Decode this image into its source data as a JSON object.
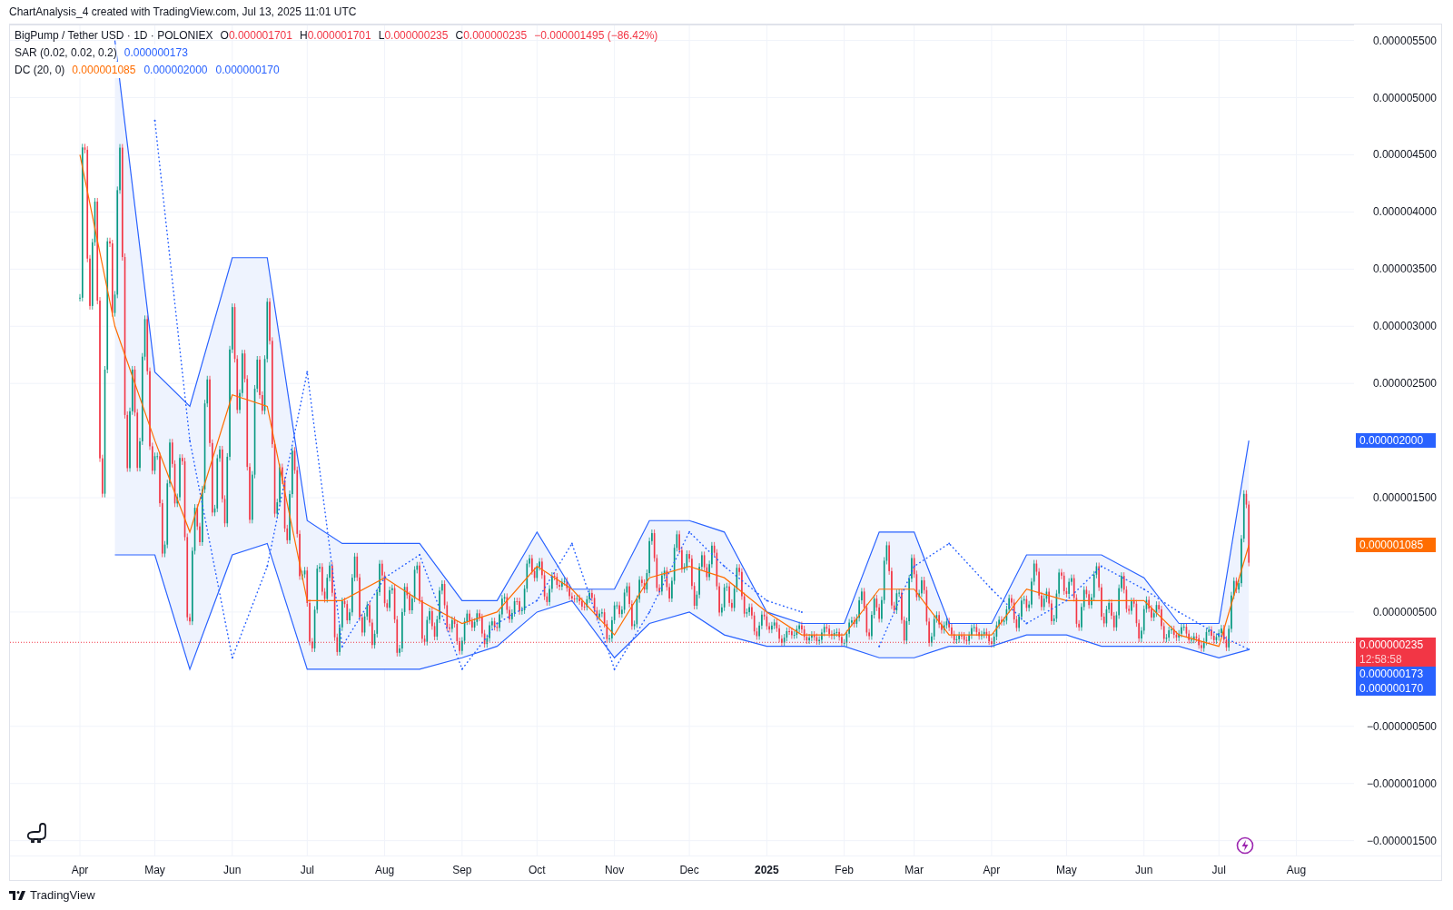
{
  "attribution": "ChartAnalysis_4 created with TradingView.com, Jul 13, 2025 11:01 UTC",
  "legend": {
    "symbol": "BigPump / Tether USD · 1D · POLONIEX",
    "ohlc": [
      {
        "label": "O",
        "value": "0.000001701"
      },
      {
        "label": "H",
        "value": "0.000001701"
      },
      {
        "label": "L",
        "value": "0.000000235"
      },
      {
        "label": "C",
        "value": "0.000000235"
      }
    ],
    "change": "−0.000001495 (−86.42%)",
    "indicators": [
      {
        "name": "SAR (0.02, 0.02, 0.2)",
        "values": [
          {
            "text": "0.000000173",
            "color": "#2962ff"
          }
        ]
      },
      {
        "name": "DC (20, 0)",
        "values": [
          {
            "text": "0.000001085",
            "color": "#ff6d00"
          },
          {
            "text": "0.000002000",
            "color": "#2962ff"
          },
          {
            "text": "0.000000170",
            "color": "#2962ff"
          }
        ]
      }
    ]
  },
  "chart": {
    "chart_data": {
      "type": "line",
      "grid": true,
      "xlim": [
        "2024-03-04",
        "2025-09-28"
      ],
      "ylim": [
        -1.63e-06,
        5.64e-06
      ],
      "x": [
        "2024-04-01",
        "2024-04-15",
        "2024-05-01",
        "2024-05-15",
        "2024-06-01",
        "2024-06-15",
        "2024-07-01",
        "2024-07-15",
        "2024-08-01",
        "2024-08-15",
        "2024-09-01",
        "2024-09-15",
        "2024-10-01",
        "2024-10-15",
        "2024-11-01",
        "2024-11-15",
        "2024-12-01",
        "2024-12-15",
        "2025-01-01",
        "2025-01-15",
        "2025-02-01",
        "2025-02-15",
        "2025-03-01",
        "2025-03-15",
        "2025-04-01",
        "2025-04-15",
        "2025-05-01",
        "2025-05-15",
        "2025-06-01",
        "2025-06-15",
        "2025-07-01",
        "2025-07-13"
      ],
      "xticks": [
        {
          "value": "2024-04-01",
          "label": "Apr"
        },
        {
          "value": "2024-05-01",
          "label": "May"
        },
        {
          "value": "2024-06-01",
          "label": "Jun"
        },
        {
          "value": "2024-07-01",
          "label": "Jul"
        },
        {
          "value": "2024-08-01",
          "label": "Aug"
        },
        {
          "value": "2024-09-01",
          "label": "Sep"
        },
        {
          "value": "2024-10-01",
          "label": "Oct"
        },
        {
          "value": "2024-11-01",
          "label": "Nov"
        },
        {
          "value": "2024-12-01",
          "label": "Dec"
        },
        {
          "value": "2025-01-01",
          "label": "2025"
        },
        {
          "value": "2025-02-01",
          "label": "Feb"
        },
        {
          "value": "2025-03-01",
          "label": "Mar"
        },
        {
          "value": "2025-04-01",
          "label": "Apr"
        },
        {
          "value": "2025-05-01",
          "label": "May"
        },
        {
          "value": "2025-06-01",
          "label": "Jun"
        },
        {
          "value": "2025-07-01",
          "label": "Jul"
        },
        {
          "value": "2025-08-01",
          "label": "Aug"
        }
      ],
      "series": [
        {
          "color": "#2962ff",
          "line_style": "solid",
          "values": [
            null,
            5.5e-06,
            2.6e-06,
            2.3e-06,
            3.6e-06,
            3.6e-06,
            1.3e-06,
            1.1e-06,
            1.1e-06,
            1.1e-06,
            6e-07,
            6e-07,
            1.2e-06,
            7e-07,
            7e-07,
            1.3e-06,
            1.3e-06,
            1.2e-06,
            5e-07,
            4e-07,
            4e-07,
            1.2e-06,
            1.2e-06,
            4e-07,
            4e-07,
            1e-06,
            1e-06,
            1e-06,
            8e-07,
            4e-07,
            4e-07,
            2e-06
          ]
        },
        {
          "color": "#ff6d00",
          "line_style": "solid",
          "values": [
            4.5e-06,
            3e-06,
            2e-06,
            1.2e-06,
            2.4e-06,
            2.3e-06,
            6e-07,
            6e-07,
            8e-07,
            6e-07,
            4e-07,
            5e-07,
            9e-07,
            7e-07,
            3e-07,
            8e-07,
            9e-07,
            8e-07,
            5e-07,
            3e-07,
            3e-07,
            7e-07,
            7e-07,
            3e-07,
            3e-07,
            7e-07,
            6e-07,
            6e-07,
            6e-07,
            3e-07,
            2e-07,
            1.085e-06
          ]
        },
        {
          "color": "#2962ff",
          "line_style": "solid",
          "values": [
            null,
            1e-06,
            1e-06,
            0.0,
            1e-06,
            1.1e-06,
            0.0,
            0.0,
            0.0,
            0.0,
            1e-07,
            2e-07,
            5e-07,
            6e-07,
            1e-07,
            4e-07,
            5e-07,
            3e-07,
            2e-07,
            2e-07,
            2e-07,
            1e-07,
            1e-07,
            2e-07,
            2e-07,
            3e-07,
            3e-07,
            2e-07,
            2e-07,
            2e-07,
            1e-07,
            1.7e-07
          ]
        },
        {
          "color": "#2962ff",
          "line_style": "dotted",
          "values": [
            null,
            null,
            4.8e-06,
            2e-06,
            1e-07,
            9e-07,
            2.6e-06,
            2e-07,
            8e-07,
            1e-06,
            0.0,
            4e-07,
            6e-07,
            1.1e-06,
            0.0,
            5e-07,
            1.2e-06,
            9e-07,
            6e-07,
            5e-07,
            null,
            2e-07,
            9e-07,
            1.1e-06,
            7e-07,
            4e-07,
            6e-07,
            9e-07,
            7e-07,
            5e-07,
            3e-07,
            1.73e-07
          ]
        }
      ],
      "yticks": [
        {
          "value": 5.5e-06,
          "label": "0.000005500"
        },
        {
          "value": 5e-06,
          "label": "0.000005000"
        },
        {
          "value": 4.5e-06,
          "label": "0.000004500"
        },
        {
          "value": 4e-06,
          "label": "0.000004000"
        },
        {
          "value": 3.5e-06,
          "label": "0.000003500"
        },
        {
          "value": 3e-06,
          "label": "0.000003000"
        },
        {
          "value": 2.5e-06,
          "label": "0.000002500"
        },
        {
          "value": 1.5e-06,
          "label": "0.000001500"
        },
        {
          "value": 5e-07,
          "label": "0.000000500"
        },
        {
          "value": -5e-07,
          "label": "−0.000000500"
        },
        {
          "value": -1e-06,
          "label": "−0.000001000"
        },
        {
          "value": -1.5e-06,
          "label": "−0.000001500"
        }
      ]
    },
    "price_badges": [
      {
        "text": "0.000002000",
        "color": "#2962ff"
      },
      {
        "text": "0.000001085",
        "color": "#ff6d00"
      },
      {
        "text": "0.000000235",
        "countdown": "12:58:58",
        "color": "#f23645"
      },
      {
        "text": "0.000000173",
        "color": "#2962ff"
      },
      {
        "text": "0.000000170",
        "color": "#2962ff"
      }
    ]
  },
  "footer": {
    "brand": "TradingView"
  }
}
